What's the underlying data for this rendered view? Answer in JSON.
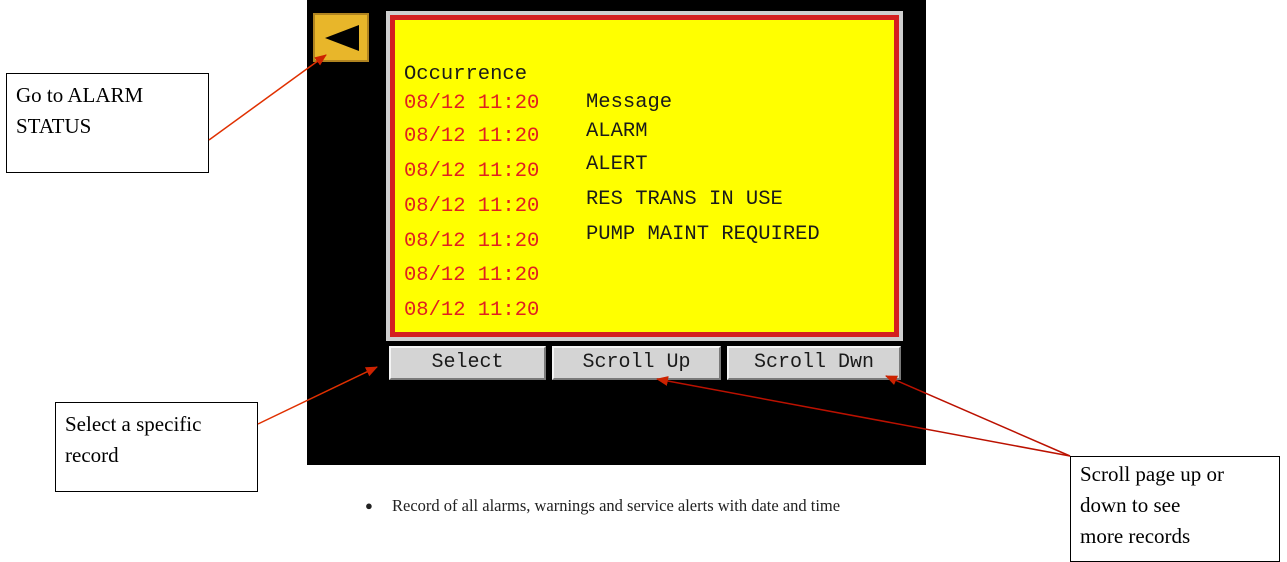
{
  "screen": {
    "header": {
      "occurrence": "Occurrence",
      "message": "Message"
    },
    "records": [
      {
        "time": "08/12 11:20",
        "message": "ALARM"
      },
      {
        "time": "08/12 11:20",
        "message": "ALERT"
      },
      {
        "time": "08/12 11:20",
        "message": "RES TRANS IN USE"
      },
      {
        "time": "08/12 11:20",
        "message": "PUMP MAINT REQUIRED"
      },
      {
        "time": "08/12 11:20",
        "message": ""
      },
      {
        "time": "08/12 11:20",
        "message": ""
      },
      {
        "time": "08/12 11:20",
        "message": ""
      }
    ]
  },
  "buttons": {
    "select": "Select",
    "scroll_up": "Scroll Up",
    "scroll_down": "Scroll Dwn"
  },
  "callouts": {
    "alarm_status": {
      "line1": "Go to ALARM",
      "line2": "STATUS"
    },
    "select": {
      "line1": "Select a specific",
      "line2": "record"
    },
    "scroll": {
      "line1": "Scroll page up or",
      "line2": "down to see",
      "line3": "more records"
    }
  },
  "note": "Record of all alarms, warnings and service alerts with date and time",
  "colors": {
    "panel": "#000000",
    "screen": "#ffff00",
    "screen_border": "#d42020",
    "time_text": "#e02020",
    "back_button": "#e8b62a",
    "arrow": "#cc2200"
  },
  "icons": {
    "back": "triangle-left-icon",
    "bullet": "bullet-icon"
  }
}
